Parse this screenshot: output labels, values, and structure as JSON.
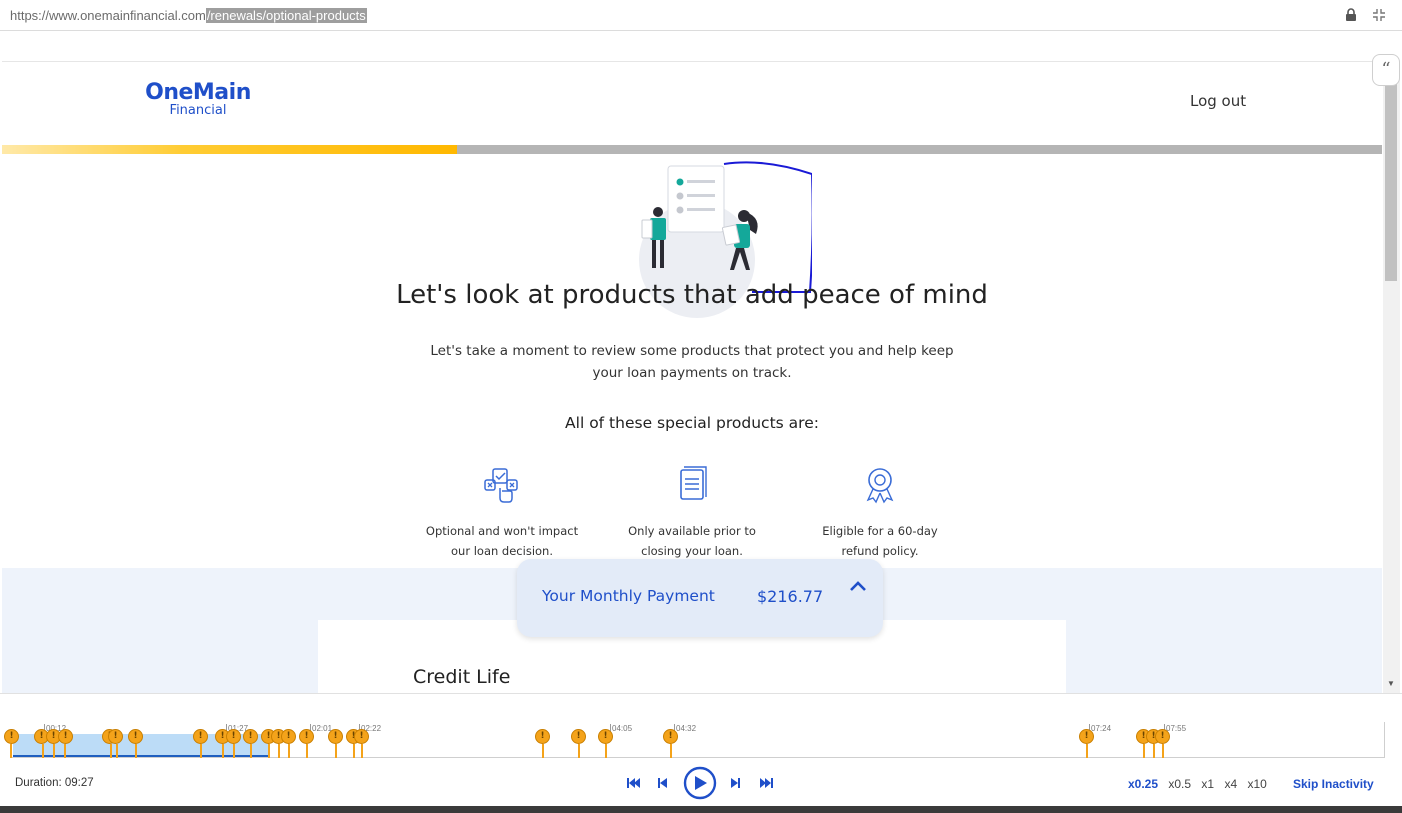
{
  "browser": {
    "url_base": "https://www.onemainfinancial.com",
    "url_path": "/renewals/optional-products"
  },
  "header": {
    "logo_main": "OneMain",
    "logo_sub": "Financial",
    "logout_label": "Log out"
  },
  "progress": {
    "percent": 33
  },
  "main": {
    "headline": "Let's look at products that add peace of mind",
    "subtext": "Let's take a moment to review some products that protect you and help keep your loan payments on track.",
    "special_heading": "All of these special products are:",
    "features": [
      {
        "icon": "choice-icon",
        "text_line1": "Optional and won't impact",
        "text_line2": "our loan decision."
      },
      {
        "icon": "document-icon",
        "text_line1": "Only available prior to",
        "text_line2": "closing your loan."
      },
      {
        "icon": "ribbon-award-icon",
        "text_line1": "Eligible for a 60-day",
        "text_line2": "refund policy."
      }
    ],
    "payment": {
      "label": "Your Monthly Payment",
      "amount": "$216.77"
    },
    "section_title": "Credit Life"
  },
  "player": {
    "duration_label": "Duration: 09:27",
    "time_labels": [
      "00:12",
      "01:27",
      "02:01",
      "02:22",
      "04:05",
      "04:32",
      "07:24",
      "07:55"
    ],
    "speeds": [
      "x0.25",
      "x0.5",
      "x1",
      "x4",
      "x10"
    ],
    "active_speed": "x0.25",
    "skip_label": "Skip Inactivity"
  },
  "colors": {
    "brand_blue": "#1f4fc9",
    "progress_yellow": "#ffb800",
    "marker_orange": "#f4a31a",
    "annotation_blue": "#1a1ad6"
  }
}
